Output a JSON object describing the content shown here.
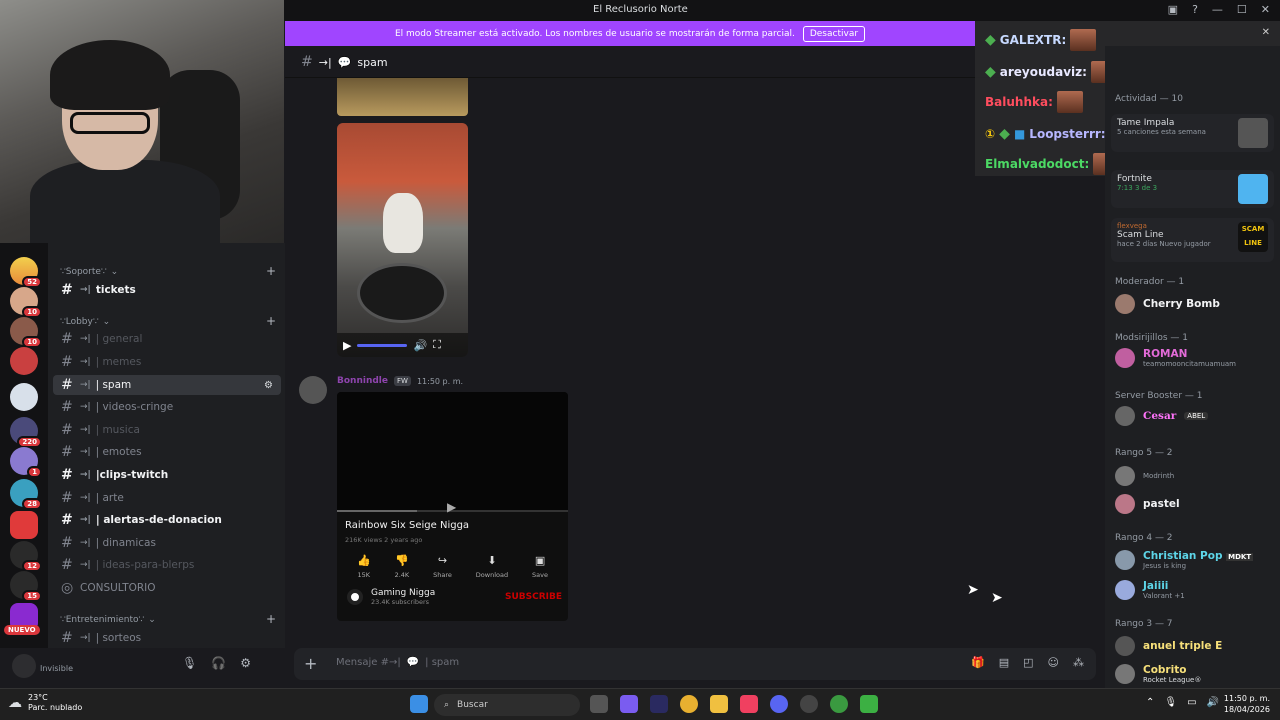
{
  "window": {
    "title": "El Reclusorio Norte"
  },
  "banner": {
    "text": "El modo Streamer está activado. Los nombres de usuario se mostrarán de forma parcial.",
    "button": "Desactivar"
  },
  "header": {
    "prefix": "→|",
    "name": "spam"
  },
  "search": {
    "placeholder": "Buscar El Reclusorio Norte"
  },
  "servers": {
    "badges": [
      "52",
      "10",
      "10",
      "220",
      "1",
      "28",
      "12",
      "15"
    ],
    "new_label": "NUEVO"
  },
  "categories": {
    "support": "∵Soporte∵",
    "lobby": "∵Lobby∵",
    "entertainment": "∵Entretenimiento∵"
  },
  "channels": [
    {
      "prefix": "→|",
      "name": "tickets"
    },
    {
      "prefix": "→|",
      "name": "| general"
    },
    {
      "prefix": "→|",
      "name": "| memes"
    },
    {
      "prefix": "→|",
      "name": "| spam"
    },
    {
      "prefix": "→|",
      "name": "| videos-cringe"
    },
    {
      "prefix": "→|",
      "name": "| musica"
    },
    {
      "prefix": "→|",
      "name": "| emotes"
    },
    {
      "prefix": "→|",
      "name": "|clips-twitch"
    },
    {
      "prefix": "→|",
      "name": "| arte"
    },
    {
      "prefix": "→|",
      "name": "| alertas-de-donacion"
    },
    {
      "prefix": "→|",
      "name": "| dinamicas"
    },
    {
      "prefix": "→|",
      "name": "| ideas-para-blerps"
    },
    {
      "prefix": "",
      "name": "CONSULTORIO"
    },
    {
      "prefix": "→|",
      "name": "| sorteos"
    }
  ],
  "user": {
    "status": "Invisible"
  },
  "message": {
    "author": "Bonnindle",
    "tag": "FW",
    "time": "11:50 p. m."
  },
  "youtube": {
    "title": "Rainbow Six Seige Nigga",
    "meta": "216K views  2 years ago",
    "actions": [
      {
        "icon": "👍",
        "label": "15K"
      },
      {
        "icon": "👎",
        "label": "2.4K"
      },
      {
        "icon": "↪",
        "label": "Share"
      },
      {
        "icon": "⬇",
        "label": "Download"
      },
      {
        "icon": "▣",
        "label": "Save"
      }
    ],
    "channel": "Gaming Nigga",
    "subs": "23.4K subscribers",
    "subscribe": "SUBSCRIBE"
  },
  "input": {
    "placeholder": "Mensaje #→|",
    "channel": "| spam"
  },
  "overlay": {
    "names": [
      "GALEXTR:",
      "areyoudaviz:",
      "Baluhhka:",
      "Loopsterrr:",
      "Elmalvadodoct:"
    ]
  },
  "activity": {
    "header": "Actividad — 10",
    "cards": [
      {
        "title": "Tame Impala",
        "sub": "5 canciones esta semana"
      },
      {
        "title": "Fortnite",
        "sub": "7:13  3 de 3"
      },
      {
        "user": "flexvega",
        "title": "Scam Line",
        "sub": "hace 2 días  Nuevo jugador",
        "thumb": "SCAM LINE"
      }
    ]
  },
  "members": {
    "groups": [
      {
        "header": "Moderador — 1",
        "items": [
          {
            "name": "Cherry Bomb",
            "status": ""
          }
        ]
      },
      {
        "header": "Modsirijillos — 1",
        "items": [
          {
            "name": "ROMAN",
            "status": "teamomooncitamuamuam"
          }
        ]
      },
      {
        "header": "Server Booster — 1",
        "items": [
          {
            "name": "Cesar",
            "status": "ABEL"
          }
        ]
      },
      {
        "header": "Rango 5 — 2",
        "items": [
          {
            "name": "Modrinth",
            "status": ""
          },
          {
            "name": "pastel",
            "status": ""
          }
        ]
      },
      {
        "header": "Rango 4 — 2",
        "items": [
          {
            "name": "Christian Pop",
            "status": "Jesus is king",
            "tag": "MDKT"
          },
          {
            "name": "Jaiiii",
            "status": "Valorant +1"
          }
        ]
      },
      {
        "header": "Rango 3 — 7",
        "items": [
          {
            "name": "anuel triple E",
            "status": ""
          },
          {
            "name": "Cobrito",
            "status": "Rocket League®"
          }
        ]
      }
    ]
  },
  "taskbar": {
    "weather_temp": "23°C",
    "weather_desc": "Parc. nublado",
    "search": "Buscar",
    "time": "11:50 p. m.",
    "date": "18/04/2026"
  },
  "colors": {
    "accent": "#a045ff",
    "blurple": "#5865f2",
    "background": "#1a1a1e"
  }
}
